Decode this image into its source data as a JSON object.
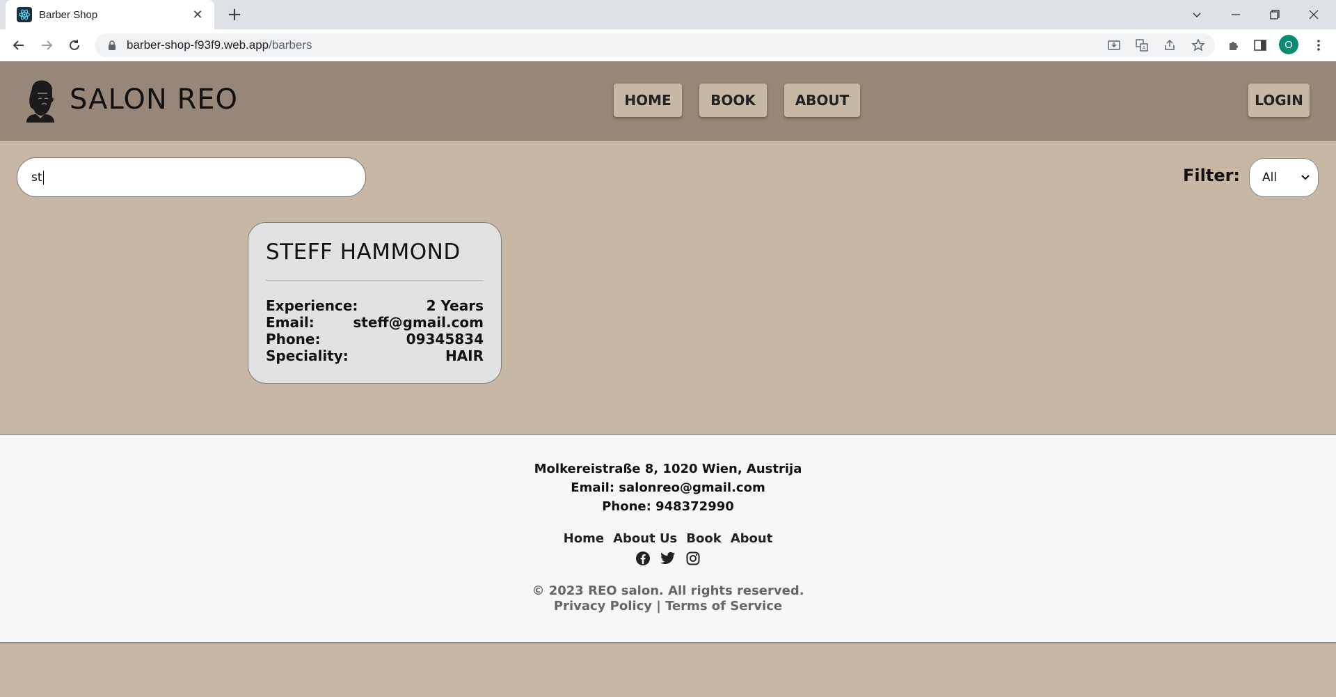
{
  "browser": {
    "tab_title": "Barber Shop",
    "url_host": "barber-shop-f93f9.web.app",
    "url_path": "/barbers",
    "profile_initial": "O"
  },
  "header": {
    "brand": "SALON REO",
    "nav": {
      "home": "HOME",
      "book": "BOOK",
      "about": "ABOUT"
    },
    "login": "LOGIN"
  },
  "search": {
    "value": "st"
  },
  "filter": {
    "label": "Filter:",
    "selected": "All"
  },
  "barbers": [
    {
      "name": "STEFF HAMMOND",
      "rows": [
        {
          "label": "Experience:",
          "value": "2 Years"
        },
        {
          "label": "Email:",
          "value": "steff@gmail.com"
        },
        {
          "label": "Phone:",
          "value": "09345834"
        },
        {
          "label": "Speciality:",
          "value": "HAIR"
        }
      ]
    }
  ],
  "footer": {
    "address": "Molkereistraße 8, 1020 Wien, Austrija",
    "email": "Email: salonreo@gmail.com",
    "phone": "Phone: 948372990",
    "links": {
      "home": "Home",
      "about_us": "About Us",
      "book": "Book",
      "about": "About"
    },
    "copyright": "© 2023 REO salon. All rights reserved.",
    "legal": "Privacy Policy | Terms of Service"
  }
}
